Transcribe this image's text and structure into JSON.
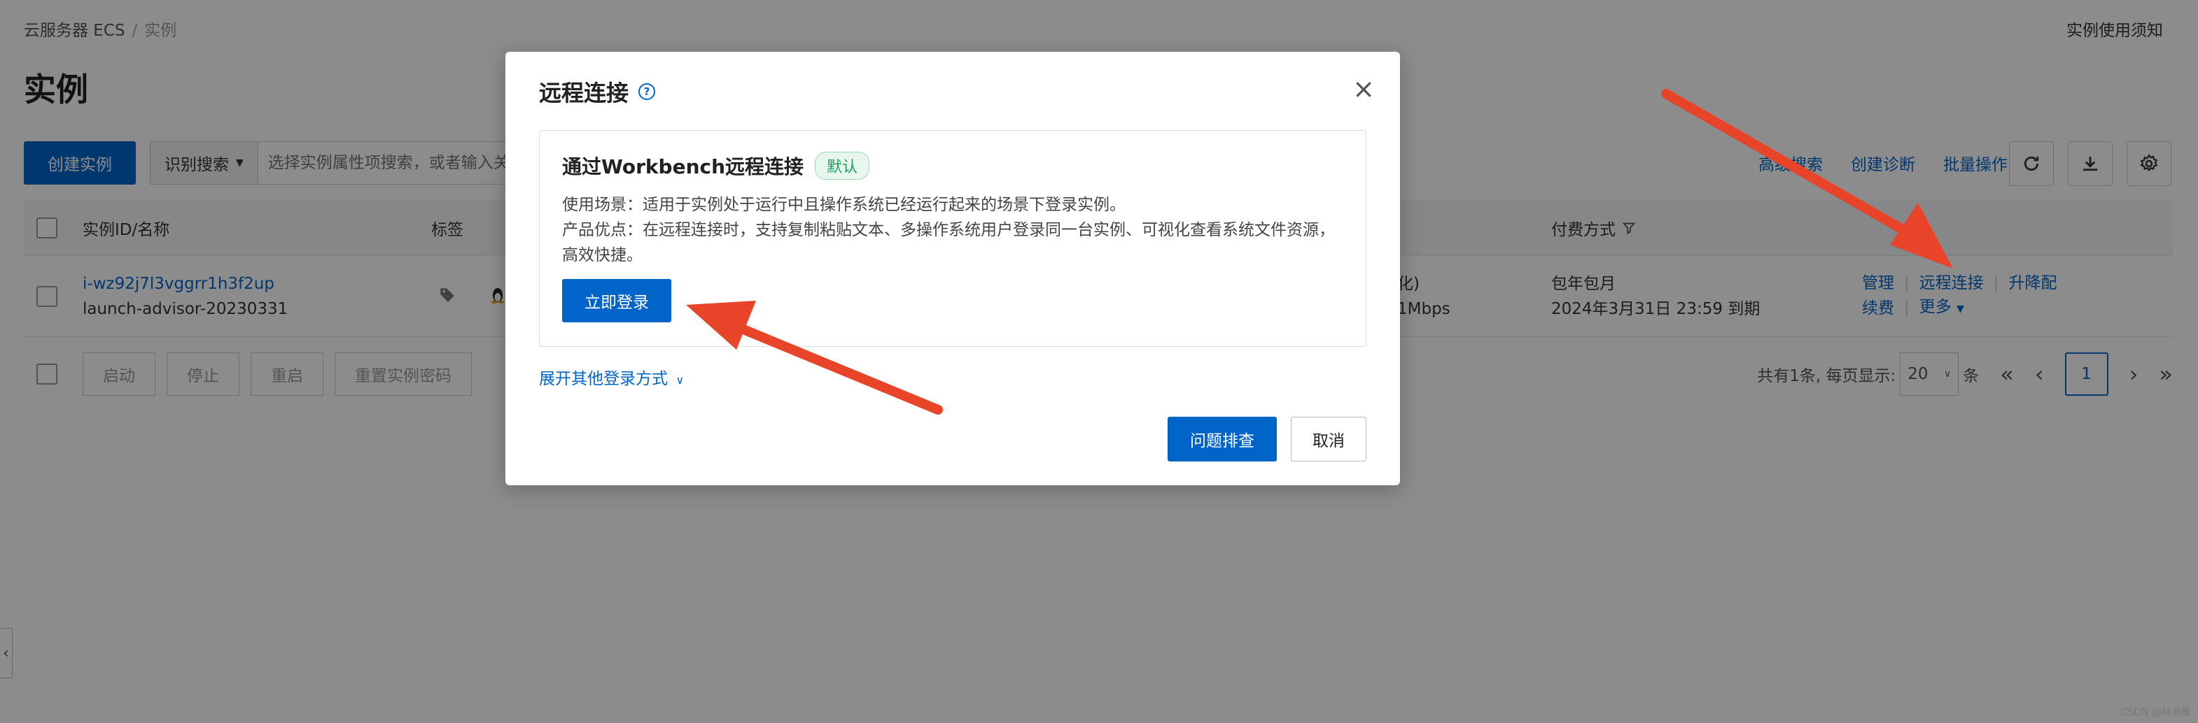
{
  "breadcrumb": {
    "root": "云服务器 ECS",
    "sep": "/",
    "current": "实例"
  },
  "header": {
    "notice_link": "实例使用须知",
    "title": "实例"
  },
  "toolbar": {
    "create_label": "创建实例",
    "search_select": "识别搜索",
    "search_placeholder": "选择实例属性项搜索，或者输入关键字识别搜索",
    "links": [
      "高级搜索",
      "创建诊断",
      "批量操作"
    ],
    "icons": [
      "refresh-icon",
      "download-icon",
      "settings-icon"
    ]
  },
  "table": {
    "headers": {
      "id_name": "实例ID/名称",
      "tags": "标签",
      "billing": "付费方式"
    },
    "row": {
      "id": "i-wz92j7l3vggrr1h3f2up",
      "name": "launch-advisor-20230331",
      "spec_line1": "化)",
      "spec_line2": "1Mbps",
      "billing_line1": "包年包月",
      "billing_line2": "2024年3月31日 23:59 到期",
      "ops": {
        "manage": "管理",
        "remote": "远程连接",
        "upgrade": "升降配",
        "renew": "续费",
        "more": "更多"
      }
    }
  },
  "batch": {
    "start": "启动",
    "stop": "停止",
    "restart": "重启",
    "reset_pwd": "重置实例密码"
  },
  "pager": {
    "summary": "共有1条, 每页显示:",
    "size": "20",
    "unit": "条",
    "page": "1"
  },
  "modal": {
    "title": "远程连接",
    "help": "?",
    "close": "×",
    "card": {
      "title": "通过Workbench远程连接",
      "badge": "默认",
      "desc1": "使用场景：适用于实例处于运行中且操作系统已经运行起来的场景下登录实例。",
      "desc2": "产品优点：在远程连接时，支持复制粘贴文本、多操作系统用户登录同一台实例、可视化查看系统文件资源，高效快捷。",
      "login_label": "立即登录"
    },
    "expand_label": "展开其他登录方式",
    "troubleshoot_label": "问题排查",
    "cancel_label": "取消"
  },
  "watermark": "CSDN @林海雁",
  "colors": {
    "primary": "#0064c8",
    "arrow": "#e8442a",
    "badge_green": "#22a05a"
  }
}
